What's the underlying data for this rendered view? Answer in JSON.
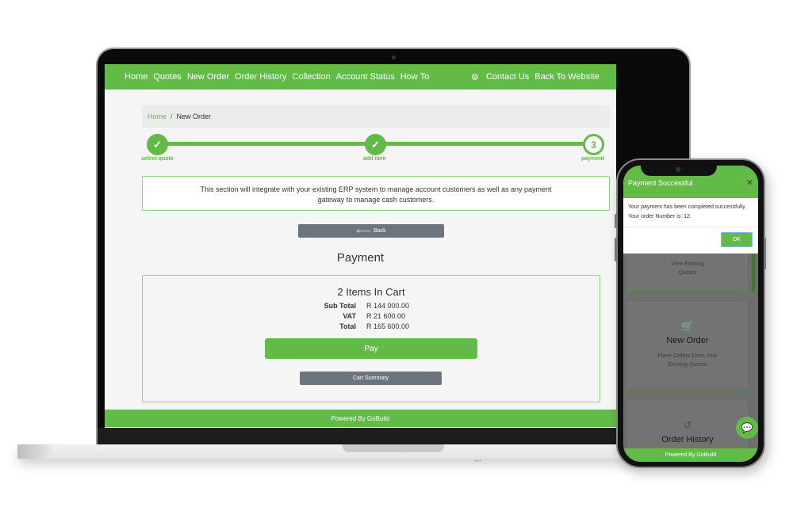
{
  "laptop": {
    "nav": {
      "items": [
        "Home",
        "Quotes",
        "New Order",
        "Order History",
        "Collection",
        "Account Status",
        "How To"
      ],
      "right_items": [
        "Contact Us",
        "Back To Website"
      ],
      "settings_icon": "gears-icon"
    },
    "breadcrumb": {
      "home": "Home",
      "separator": "/",
      "current": "New Order"
    },
    "stepper": {
      "steps": [
        {
          "label": "select quote",
          "state": "done",
          "icon": "check-icon"
        },
        {
          "label": "add item",
          "state": "done",
          "icon": "check-icon"
        },
        {
          "label": "payment",
          "state": "current",
          "number": "3"
        }
      ]
    },
    "info_text": "This section will integrate with your existing ERP system to manage account customers as well as any payment gateway to manage cash customers.",
    "back_button": {
      "icon": "arrow-left-icon",
      "label": "Back",
      "glyph": "🡐"
    },
    "payment_title": "Payment",
    "cart": {
      "title": "2 Items In Cart",
      "rows": [
        {
          "label": "Sub Total",
          "value": "R 144 000.00"
        },
        {
          "label": "VAT",
          "value": "R 21 600.00"
        },
        {
          "label": "Total",
          "value": "R 165 600.00"
        }
      ],
      "pay_label": "Pay",
      "summary_label": "Cart Summary"
    },
    "footer": "Powered By GoBuild"
  },
  "phone": {
    "modal": {
      "title": "Payment Successful",
      "close_glyph": "✕",
      "message_line1": "Your payment has been completed successfully.",
      "message_line2": "Your order Number is: 12.",
      "ok_label": "OK"
    },
    "cards": [
      {
        "description_line1": "View Existing",
        "description_line2": "Quotes"
      },
      {
        "icon": "cart-plus-icon",
        "title": "New Order",
        "description_line1": "Place Orders From Your",
        "description_line2": "Existing Quotes"
      },
      {
        "icon": "history-icon",
        "title": "Order History"
      }
    ],
    "chat_icon": "chat-bubbles-icon",
    "footer": "Powered By GoBuild"
  },
  "colors": {
    "brand_green": "#62bb46",
    "button_gray": "#6c757d",
    "info_border": "#8fd07a"
  }
}
